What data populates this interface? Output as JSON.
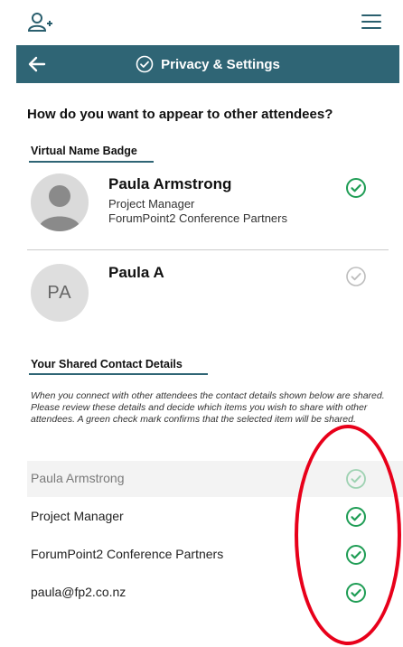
{
  "header": {
    "title": "Privacy & Settings"
  },
  "main": {
    "question": "How do you want to appear to other attendees?",
    "badge_section_label": "Virtual Name Badge",
    "badges": [
      {
        "name": "Paula Armstrong",
        "title": "Project Manager",
        "company": "ForumPoint2 Conference Partners",
        "selected": true
      },
      {
        "name": "Paula A",
        "initials": "PA",
        "selected": false
      }
    ],
    "contact_section_label": "Your Shared Contact Details",
    "contact_description": "When you connect with other attendees the contact details shown below are shared. Please review these details and decide which items you wish to share with other attendees. A green check mark confirms that the selected item will be shared.",
    "contact_items": [
      {
        "label": "Paula Armstrong",
        "enabled": false
      },
      {
        "label": "Project Manager",
        "enabled": true
      },
      {
        "label": "ForumPoint2 Conference Partners",
        "enabled": true
      },
      {
        "label": "paula@fp2.co.nz",
        "enabled": true
      }
    ]
  },
  "colors": {
    "header_bg": "#2f6575",
    "check_green": "#1f9d55",
    "check_muted": "#bdbdbd",
    "annotation_red": "#e8001a"
  }
}
